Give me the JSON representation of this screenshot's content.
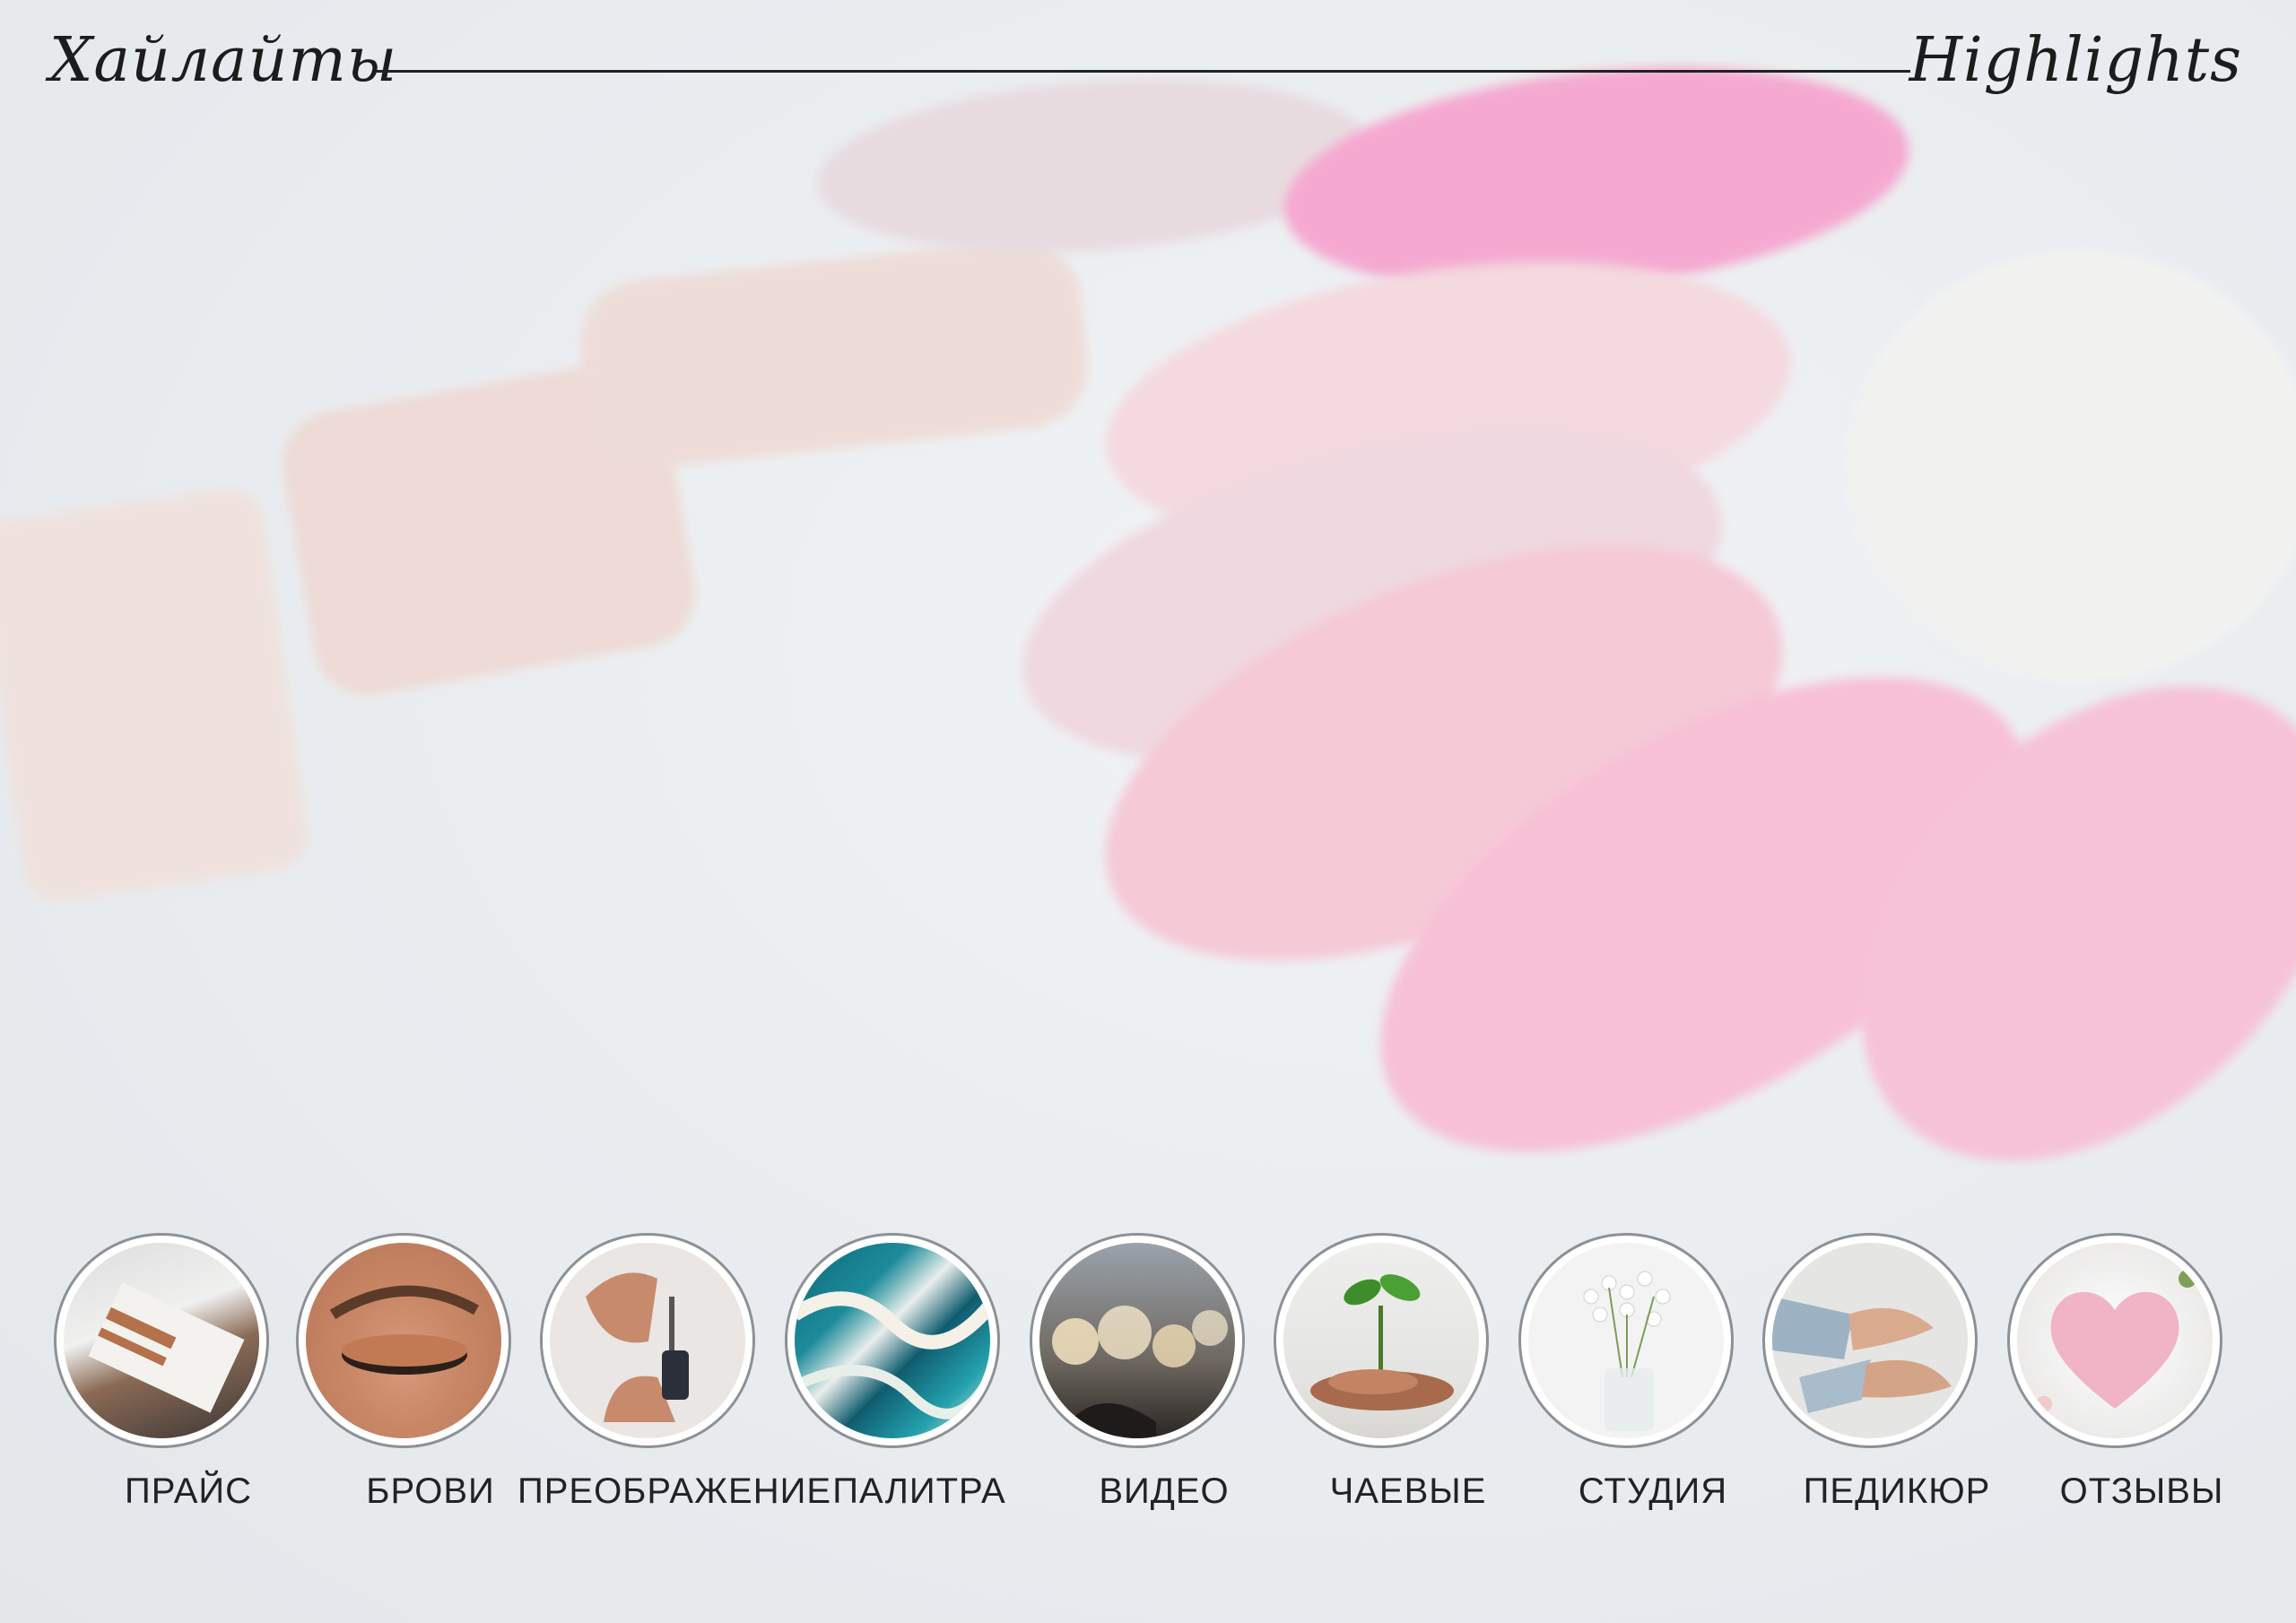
{
  "header": {
    "title_ru": "Хайлайты",
    "title_en": "Highlights"
  },
  "highlights": [
    {
      "label": "ПРАЙС",
      "icon": "book-icon"
    },
    {
      "label": "БРОВИ",
      "icon": "eye-makeup-icon"
    },
    {
      "label": "ПРЕОБРАЖЕНИЕ",
      "icon": "serum-dropper-icon"
    },
    {
      "label": "ПАЛИТРА",
      "icon": "marble-swirl-icon"
    },
    {
      "label": "ВИДЕО",
      "icon": "bokeh-lights-icon"
    },
    {
      "label": "ЧАЕВЫЕ",
      "icon": "coins-sprout-icon"
    },
    {
      "label": "СТУДИЯ",
      "icon": "flowers-vase-icon"
    },
    {
      "label": "ПЕДИКЮР",
      "icon": "feet-icon"
    },
    {
      "label": "ОТЗЫВЫ",
      "icon": "heart-icon"
    }
  ],
  "colors": {
    "accent_pink": "#f3b3cc",
    "nail_pale": "#f2dfdf",
    "ring_border": "#8d9096"
  }
}
